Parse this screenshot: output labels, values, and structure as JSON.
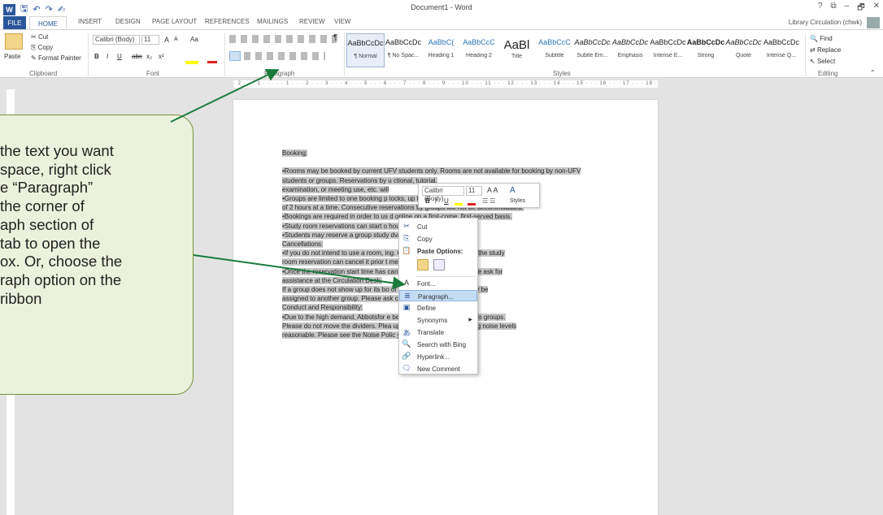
{
  "window": {
    "title": "Document1 - Word",
    "user": "Library Circulation (chwk)",
    "help": "?",
    "restore": "⧉",
    "minimize": "–",
    "maximize": "🗗",
    "close": "✕"
  },
  "qat": {
    "logo": "W",
    "save": "🖫",
    "undo": "↶",
    "redo": "↷",
    "touch": "✍"
  },
  "tabs": [
    "FILE",
    "HOME",
    "INSERT",
    "DESIGN",
    "PAGE LAYOUT",
    "REFERENCES",
    "MAILINGS",
    "REVIEW",
    "VIEW"
  ],
  "ribbon": {
    "clipboard": {
      "label": "Clipboard",
      "paste": "Paste",
      "cut": "Cut",
      "copy": "Copy",
      "format_painter": "Format Painter"
    },
    "font": {
      "label": "Font",
      "name": "Calibri (Body)",
      "size": "11",
      "grow": "A",
      "shrink": "A",
      "case": "Aa",
      "bold": "B",
      "italic": "I",
      "underline": "U",
      "strike": "abc",
      "sub": "x₂",
      "sup": "x²"
    },
    "paragraph": {
      "label": "Paragraph",
      "pilcrow": "¶"
    },
    "styles": {
      "label": "Styles",
      "items": [
        {
          "sample": "AaBbCcDc",
          "name": "¶ Normal"
        },
        {
          "sample": "AaBbCcDc",
          "name": "¶ No Spac..."
        },
        {
          "sample": "AaBbC(",
          "name": "Heading 1"
        },
        {
          "sample": "AaBbCcC",
          "name": "Heading 2"
        },
        {
          "sample": "AaBl",
          "name": "Title"
        },
        {
          "sample": "AaBbCcC",
          "name": "Subtitle"
        },
        {
          "sample": "AaBbCcDc",
          "name": "Subtle Em..."
        },
        {
          "sample": "AaBbCcDc",
          "name": "Emphasis"
        },
        {
          "sample": "AaBbCcDc",
          "name": "Intense E..."
        },
        {
          "sample": "AaBbCcDc",
          "name": "Strong"
        },
        {
          "sample": "AaBbCcDc",
          "name": "Quote"
        },
        {
          "sample": "AaBbCcDc",
          "name": "Intense Q..."
        }
      ]
    },
    "editing": {
      "label": "Editing",
      "find": "Find",
      "replace": "Replace",
      "select": "Select"
    }
  },
  "ruler": {
    "marks": "· 2 · · · 1 · · · · · 1 · · · 2 · · · 3 · · · 4 · · · 5 · · · 6 · · · 7 · · · 8 · · · 9 · · · 10 · · · 11 · · · 12 · · · 13 · · · 14 · · · 15 · · · 16 · · · 17 · · · 18 · · · 19"
  },
  "document": {
    "lines": [
      "Booking:",
      "",
      "•Rooms may be booked by current UFV students only. Rooms are not available for booking by non-UFV",
      "students or groups. Reservations by u                                              ctional, tutorial,",
      "examination, or meeting use, etc. will",
      "•Groups are limited to one booking p                                    locks, up to a maximum",
      "of 2 hours at a time. Consecutive reservations by groups will not be accommodated.",
      "•Bookings are required in order to us                             d online on a first-come, first-served basis.",
      "•Study room reservations can start o                              hour.",
      "•Students may reserve a group study                             dvance.",
      "Cancellations:",
      "•If you do not intend to use a room,                                     ing. Only the student who made the study",
      "room reservation can cancel it prior t                                 me.",
      "•Once the reservation start time has                              can cancel a reservation. Please ask for",
      "assistance at the Circulation Desk.",
      "If a group does not show up for its bo                           of the start time, the room may be",
      "assigned to another group. Please ask                           culation Desk.",
      " Conduct and Responsibility:",
      "•Due to the high demand, Abbotsfor                               e been split to accommodate two groups.",
      "Please do not move the dividers. Plea                            upants of the room by keeping noise levels",
      "reasonable. Please see the Noise Polic                            y."
    ]
  },
  "mini_toolbar": {
    "font": "Calibri (Body)",
    "size": "11",
    "styles": "Styles",
    "bold": "B",
    "italic": "I",
    "underline": "U"
  },
  "context_menu": {
    "cut": "Cut",
    "copy": "Copy",
    "paste_options": "Paste Options:",
    "font": "Font...",
    "paragraph": "Paragraph...",
    "define": "Define",
    "synonyms": "Synonyms",
    "translate": "Translate",
    "search": "Search with Bing",
    "hyperlink": "Hyperlink...",
    "comment": "New Comment"
  },
  "callout": {
    "lines": [
      "the text you want",
      "space, right click",
      "e “Paragraph”",
      " the corner of",
      "aph section of",
      "tab to open the",
      "ox. Or, choose the",
      "raph option on the",
      " ribbon"
    ]
  },
  "colors": {
    "accent": "#2b579a",
    "callout_fill": "#ebf1dd",
    "callout_border": "#77933c",
    "arrow": "#1a7a3c",
    "selection": "#c8c8c8"
  }
}
